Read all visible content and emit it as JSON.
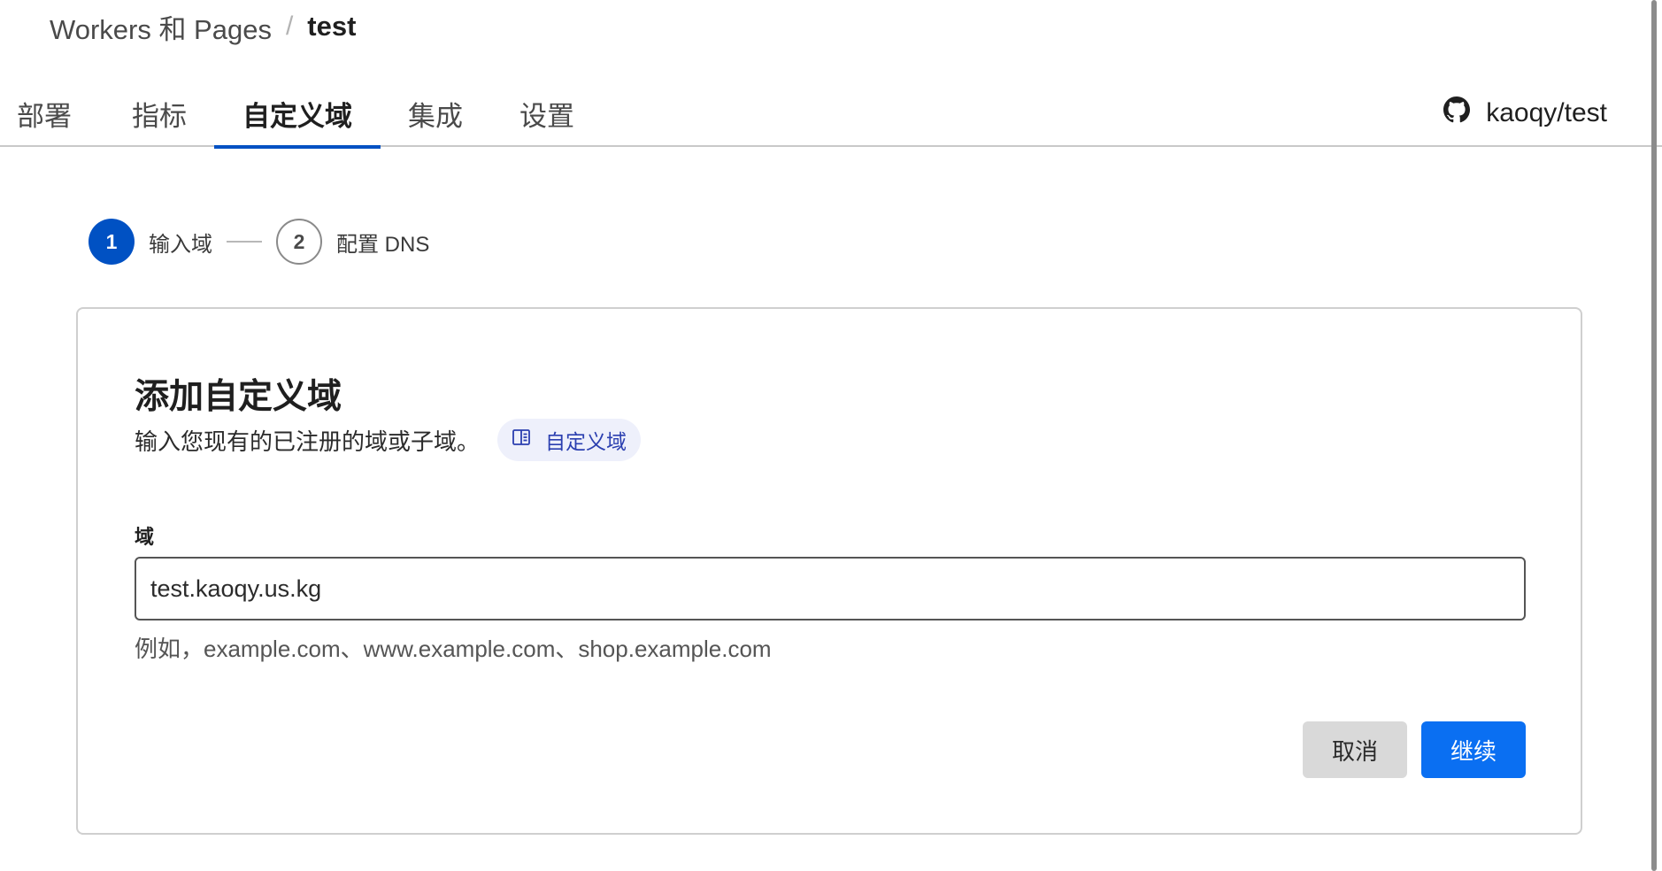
{
  "breadcrumb": {
    "parent": "Workers 和 Pages",
    "separator": "/",
    "current": "test"
  },
  "tabs": [
    {
      "label": "部署",
      "active": false
    },
    {
      "label": "指标",
      "active": false
    },
    {
      "label": "自定义域",
      "active": true
    },
    {
      "label": "集成",
      "active": false
    },
    {
      "label": "设置",
      "active": false
    }
  ],
  "repo": {
    "icon": "github-icon",
    "label": "kaoqy/test"
  },
  "stepper": {
    "steps": [
      {
        "number": "1",
        "label": "输入域",
        "state": "current"
      },
      {
        "number": "2",
        "label": "配置 DNS",
        "state": "upcoming"
      }
    ]
  },
  "card": {
    "title": "添加自定义域",
    "description": "输入您现有的已注册的域或子域。",
    "doc_link": {
      "icon": "book-icon",
      "label": "自定义域"
    },
    "field": {
      "label": "域",
      "value": "test.kaoqy.us.kg",
      "hint": "例如，example.com、www.example.com、shop.example.com"
    },
    "buttons": {
      "cancel": "取消",
      "continue": "继续"
    }
  },
  "colors": {
    "accent": "#0051c3",
    "primary_button": "#0a6ff2",
    "secondary_button": "#d9d9d9",
    "doc_pill_bg": "#eef0fb",
    "doc_pill_text": "#2b3fb0"
  }
}
